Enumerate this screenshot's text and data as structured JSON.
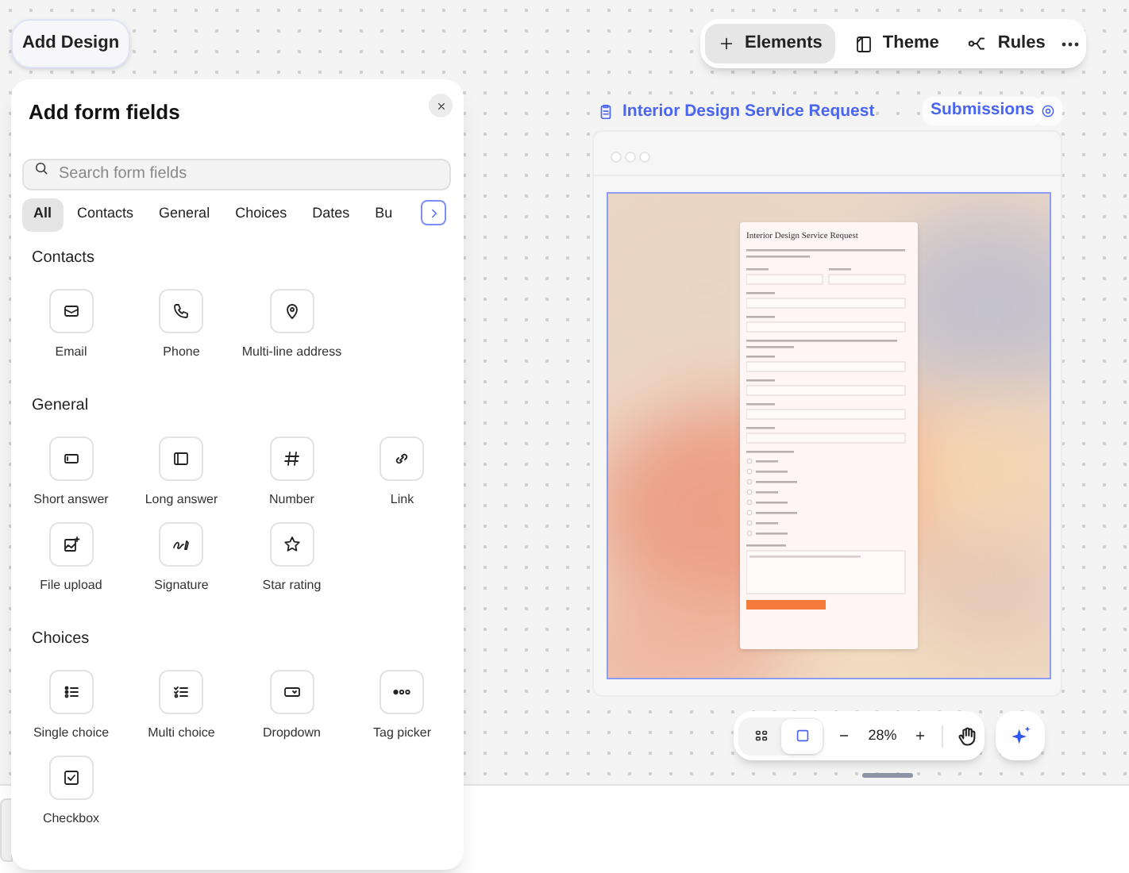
{
  "add_design_button": "Add Design",
  "top_toolbar": {
    "buttons": [
      {
        "label": "Elements",
        "selected": true
      },
      {
        "label": "Theme",
        "selected": false
      },
      {
        "label": "Rules",
        "selected": false
      }
    ]
  },
  "panel": {
    "title": "Add form fields",
    "search": {
      "placeholder": "Search form fields"
    },
    "tabs": [
      {
        "label": "All",
        "selected": true
      },
      {
        "label": "Contacts",
        "selected": false
      },
      {
        "label": "General",
        "selected": false
      },
      {
        "label": "Choices",
        "selected": false
      },
      {
        "label": "Dates",
        "selected": false
      },
      {
        "label": "Bu",
        "selected": false
      }
    ],
    "sections": [
      {
        "title": "Contacts",
        "items": [
          "Email",
          "Phone",
          "Multi-line address"
        ]
      },
      {
        "title": "General",
        "items": [
          "Short answer",
          "Long answer",
          "Number",
          "Link",
          "File upload",
          "Signature",
          "Star rating"
        ]
      },
      {
        "title": "Choices",
        "items": [
          "Single choice",
          "Multi choice",
          "Dropdown",
          "Tag picker",
          "Checkbox"
        ]
      }
    ]
  },
  "form_header": {
    "title": "Interior Design Service Request",
    "submissions_button": "Submissions"
  },
  "form_preview": {
    "title": "Interior Design Service Request"
  },
  "zoom_toolbar": {
    "views": [
      {
        "selected": false
      },
      {
        "selected": true
      }
    ],
    "zoom": "28%"
  }
}
